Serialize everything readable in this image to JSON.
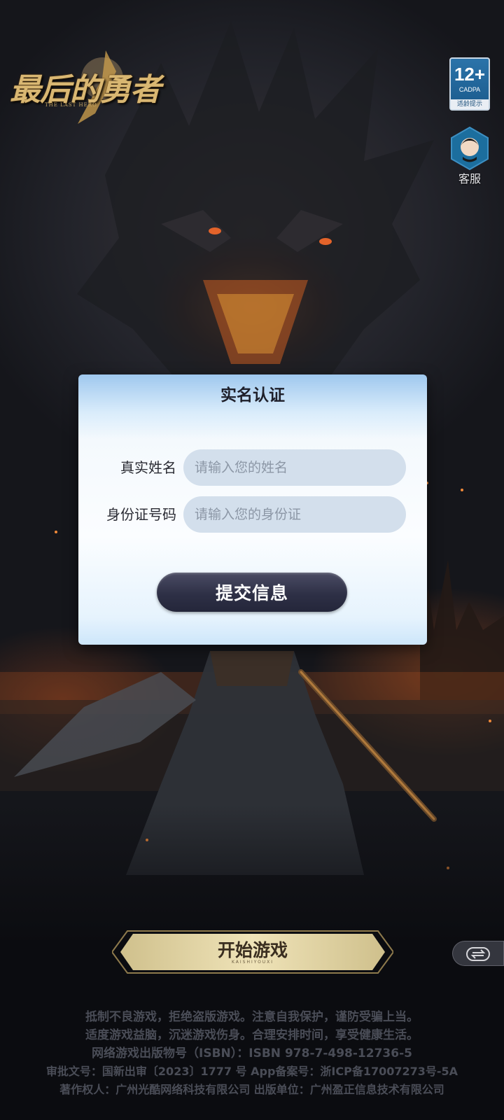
{
  "logo": {
    "title": "最后的勇者",
    "subtitle": "THE LAST HERO"
  },
  "age_badge": {
    "rating": "12+",
    "org": "CADPA",
    "hint": "适龄提示"
  },
  "service": {
    "label": "客服",
    "icon": "customer-service-icon"
  },
  "dialog": {
    "title": "实名认证",
    "name_label": "真实姓名",
    "name_placeholder": "请输入您的姓名",
    "name_value": "",
    "id_label": "身份证号码",
    "id_placeholder": "请输入您的身份证",
    "id_value": "",
    "submit_label": "提交信息"
  },
  "start_game": {
    "label": "开始游戏",
    "sub": "KAISHIYOUXI"
  },
  "switch": {
    "icon": "switch-account-icon"
  },
  "footer": {
    "line1": "抵制不良游戏，拒绝盗版游戏。注意自我保护，谨防受骗上当。",
    "line2": "适度游戏益脑，沉迷游戏伤身。合理安排时间，享受健康生活。",
    "line3": "网络游戏出版物号（ISBN）：ISBN 978-7-498-12736-5",
    "line4": "审批文号：国新出审〔2023〕1777 号  App备案号：浙ICP备17007273号-5A",
    "line5": "著作权人：广州光酷网络科技有限公司  出版单位：广州盈正信息技术有限公司"
  },
  "colors": {
    "dialog_bg": "#f4f9fd",
    "input_bg": "#d3dfec",
    "submit_bg": "#2e3046",
    "start_gold": "#e6d7a4",
    "age_blue": "#2b73a9"
  }
}
